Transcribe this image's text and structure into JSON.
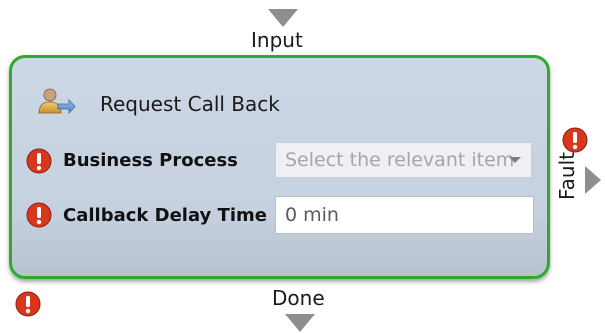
{
  "ports": {
    "input_label": "Input",
    "done_label": "Done",
    "fault_label": "Fault"
  },
  "node": {
    "title": "Request Call Back",
    "icon": "person-arrow-icon",
    "fields": [
      {
        "label": "Business Process",
        "type": "select",
        "placeholder": "Select the relevant item",
        "error": true
      },
      {
        "label": "Callback Delay Time",
        "type": "text",
        "value": "0 min",
        "error": true
      }
    ]
  },
  "status": {
    "fault_error": true,
    "node_error": true
  },
  "colors": {
    "node_border": "#2faa2f",
    "node_fill": "#ccd7e5",
    "error_red": "#d9361e",
    "port_gray": "#8e8e8e"
  }
}
